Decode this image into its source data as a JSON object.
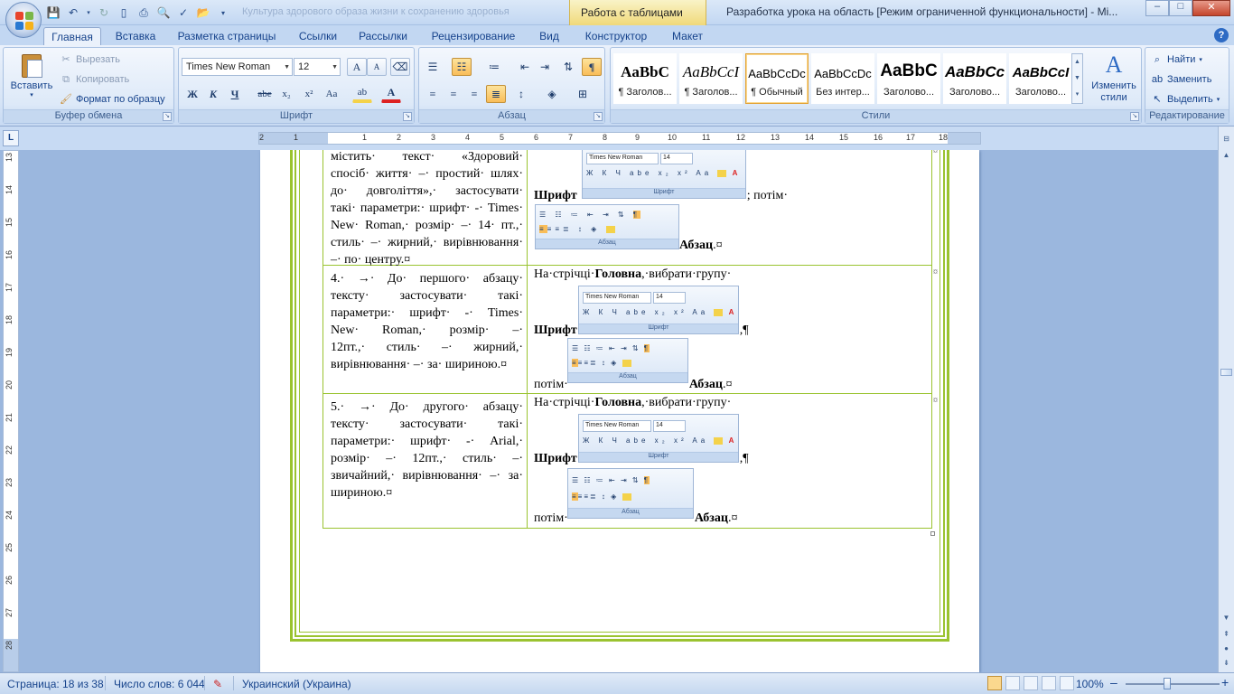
{
  "titlebar": {
    "doc_ghost": "Культура здорового образа жизни к сохранению здоровья",
    "context_tab": "Работа с таблицами",
    "window_title": "Разработка урока на область [Режим ограниченной функциональности] - Mi...",
    "minimize": "–",
    "maximize": "□",
    "close": "✕"
  },
  "tabs": [
    "Главная",
    "Вставка",
    "Разметка страницы",
    "Ссылки",
    "Рассылки",
    "Рецензирование",
    "Вид",
    "Конструктор",
    "Макет"
  ],
  "help": "?",
  "clipboard": {
    "paste": "Вставить",
    "cut": "Вырезать",
    "copy": "Копировать",
    "format_painter": "Формат по образцу",
    "label": "Буфер обмена"
  },
  "font": {
    "name": "Times New Roman",
    "size": "12",
    "grow": "A",
    "shrink": "A",
    "bold": "Ж",
    "italic": "К",
    "underline": "Ч",
    "strike": "abe",
    "sub": "x₂",
    "sup": "x²",
    "case": "Aa",
    "highlight": "ab",
    "color": "A",
    "label": "Шрифт"
  },
  "paragraph": {
    "label": "Абзац",
    "pilcrow": "¶"
  },
  "styles": {
    "items": [
      {
        "preview": "AaBbC",
        "name": "¶ Заголов..."
      },
      {
        "preview": "AaBbCcI",
        "name": "¶ Заголов..."
      },
      {
        "preview": "AaBbCcDc",
        "name": "¶ Обычный"
      },
      {
        "preview": "AaBbCcDc",
        "name": "Без интер..."
      },
      {
        "preview": "AaBbC",
        "name": "Заголово..."
      },
      {
        "preview": "AaBbCc",
        "name": "Заголово..."
      },
      {
        "preview": "AaBbCcI",
        "name": "Заголово..."
      }
    ],
    "change": "Изменить стили",
    "label": "Стили"
  },
  "editing": {
    "find": "Найти",
    "replace": "Заменить",
    "select": "Выделить",
    "label": "Редактирование"
  },
  "ruler": {
    "h_numbers": [
      "2",
      "1",
      "1",
      "2",
      "3",
      "4",
      "5",
      "6",
      "7",
      "8",
      "9",
      "10",
      "11",
      "12",
      "13",
      "14",
      "15",
      "16",
      "17",
      "18"
    ],
    "v_numbers": [
      "13",
      "14",
      "15",
      "16",
      "17",
      "18",
      "19",
      "20",
      "21",
      "22",
      "23",
      "24",
      "25",
      "26",
      "27",
      "28"
    ]
  },
  "document": {
    "row1": {
      "left_lines": [
        "містить· текст· «Здоровий·",
        "спосіб· життя· –· простий· шлях·",
        "до· довголіття»,· застосувати·",
        "такі· параметри:· шрифт· -· Times·",
        "New· Roman,· розмір· –· 14· пт.,·",
        "стиль· –· жирний,· вирівнювання·",
        "–· по· центру.¤"
      ],
      "r_bold_1": "Шрифт",
      "r_after_1": "; потім·",
      "r_bold_2": "Абзац",
      "r_after_2": ".¤"
    },
    "row2": {
      "left_lines": [
        "4.· →· До· першого· абзацу·",
        "тексту· застосувати· такі·",
        "параметри:· шрифт· -· Times·",
        "New· Roman,· розмір· –·",
        "12пт.,· стиль· –· жирний,·",
        "вирівнювання· –· за· шириною.¤"
      ],
      "r_intro": "На·стрічці·",
      "r_intro_bold": "Головна",
      "r_intro_end": ",·вибрати·групу·",
      "r_bold_1": "Шрифт",
      "r_after_1": ",¶",
      "r_then": "потім·",
      "r_bold_2": "Абзац",
      "r_after_2": ".¤"
    },
    "row3": {
      "left_lines": [
        "5.· →· До· другого· абзацу·",
        "тексту· застосувати· такі·",
        "параметри:· шрифт· -· Arial,·",
        "розмір· –· 12пт.,· стиль· –·",
        "звичайний,· вирівнювання· –· за·",
        "шириною.¤"
      ],
      "r_intro": "На·стрічці·",
      "r_intro_bold": "Головна",
      "r_intro_end": ",·вибрати·групу·",
      "r_bold_1": "Шрифт",
      "r_after_1": ",¶",
      "r_then": "потім·",
      "r_bold_2": "Абзац",
      "r_after_2": ".¤"
    },
    "mini_font": {
      "name": "Times New Roman",
      "size": "14",
      "label": "Шрифт"
    },
    "mini_para": {
      "label": "Абзац"
    },
    "cell_mark": "¤"
  },
  "statusbar": {
    "page": "Страница: 18 из 38",
    "words": "Число слов: 6 044",
    "language": "Украинский (Украина)",
    "zoom": "100%",
    "zoom_out": "–",
    "zoom_in": "+"
  },
  "colors": {
    "accent": "#15428b",
    "ribbon": "#dbe8f8",
    "table_border": "#9ac330",
    "doc_bg": "#9bb7de"
  }
}
